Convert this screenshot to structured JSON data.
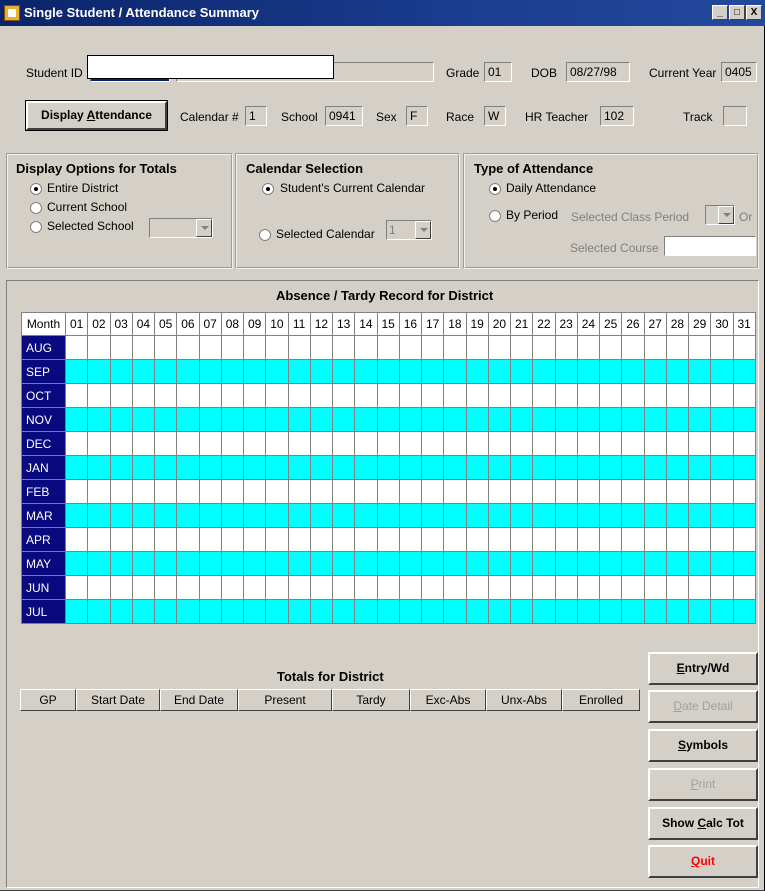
{
  "window": {
    "title": "Single Student / Attendance Summary",
    "controls": [
      "_",
      "□",
      "X"
    ]
  },
  "student": {
    "id_label": "Student ID",
    "grade_label": "Grade",
    "grade": "01",
    "dob_label": "DOB",
    "dob": "08/27/98",
    "current_year_label": "Current Year",
    "current_year": "0405",
    "calendar_label": "Calendar #",
    "calendar": "1",
    "school_label": "School",
    "school": "0941",
    "sex_label": "Sex",
    "sex": "F",
    "race_label": "Race",
    "race": "W",
    "hr_teacher_label": "HR Teacher",
    "hr_teacher": "102",
    "track_label": "Track",
    "track": ""
  },
  "display_attendance_button": {
    "pre": "Display ",
    "accel": "A",
    "post": "ttendance"
  },
  "display_options": {
    "title": "Display Options for Totals",
    "options": [
      "Entire District",
      "Current School",
      "Selected School"
    ],
    "selected": "Entire District"
  },
  "calendar_selection": {
    "title": "Calendar Selection",
    "options": [
      "Student's Current Calendar",
      "Selected Calendar"
    ],
    "selected": "Student's Current Calendar",
    "selected_calendar_value": "1"
  },
  "type_of_attendance": {
    "title": "Type of Attendance",
    "options": [
      "Daily Attendance",
      "By Period"
    ],
    "selected": "Daily Attendance",
    "class_period_label": "Selected Class Period",
    "or_label": "Or",
    "course_label": "Selected Course"
  },
  "attendance_grid": {
    "title": "Absence / Tardy Record for District",
    "month_header": "Month",
    "days": [
      "01",
      "02",
      "03",
      "04",
      "05",
      "06",
      "07",
      "08",
      "09",
      "10",
      "11",
      "12",
      "13",
      "14",
      "15",
      "16",
      "17",
      "18",
      "19",
      "20",
      "21",
      "22",
      "23",
      "24",
      "25",
      "26",
      "27",
      "28",
      "29",
      "30",
      "31"
    ],
    "months": [
      "AUG",
      "SEP",
      "OCT",
      "NOV",
      "DEC",
      "JAN",
      "FEB",
      "MAR",
      "APR",
      "MAY",
      "JUN",
      "JUL"
    ]
  },
  "totals": {
    "title": "Totals for District",
    "columns": [
      "GP",
      "Start Date",
      "End Date",
      "Present",
      "Tardy",
      "Exc-Abs",
      "Unx-Abs",
      "Enrolled"
    ]
  },
  "side_buttons": [
    {
      "key": "entry",
      "accel": "E",
      "post": "ntry/Wd",
      "enabled": true
    },
    {
      "key": "date-detail",
      "accel": "D",
      "post": "ate Detail",
      "enabled": false
    },
    {
      "key": "symbols",
      "accel": "S",
      "post": "ymbols",
      "enabled": true
    },
    {
      "key": "print",
      "accel": "P",
      "post": "rint",
      "enabled": false
    },
    {
      "key": "show-calc-tot",
      "pre": "Show ",
      "accel": "C",
      "post": "alc Tot",
      "enabled": true
    },
    {
      "key": "quit",
      "accel": "Q",
      "post": "uit",
      "enabled": true
    }
  ],
  "colors": {
    "titlebar": "#0a246a",
    "month_cell": "#0a0a80",
    "row_highlight": "#00ffff",
    "quit_text": "#ff0000"
  }
}
